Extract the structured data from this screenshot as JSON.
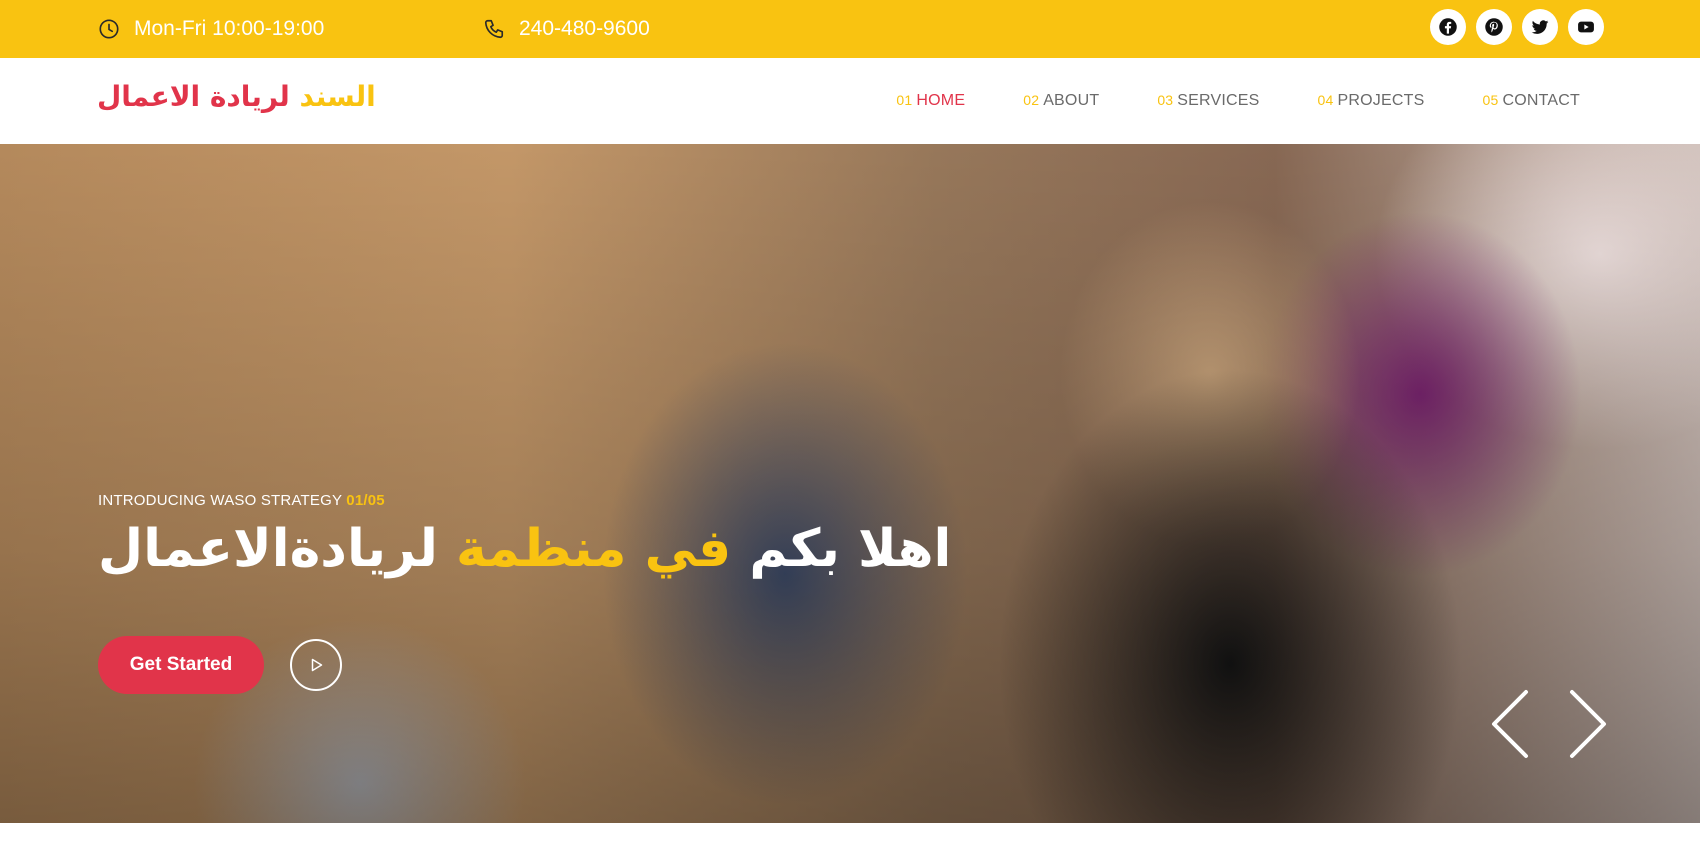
{
  "topbar": {
    "hours": "Mon-Fri 10:00-19:00",
    "phone": "240-480-9600",
    "socials": [
      {
        "name": "facebook-icon"
      },
      {
        "name": "pinterest-icon"
      },
      {
        "name": "twitter-icon"
      },
      {
        "name": "youtube-icon"
      }
    ]
  },
  "header": {
    "logo_part1": "السند",
    "logo_part2": "لريادة الاعمال",
    "nav": [
      {
        "num": "01",
        "label": "HOME",
        "active": true
      },
      {
        "num": "02",
        "label": "ABOUT"
      },
      {
        "num": "03",
        "label": "SERVICES"
      },
      {
        "num": "04",
        "label": "PROJECTS"
      },
      {
        "num": "05",
        "label": "CONTACT"
      }
    ]
  },
  "hero": {
    "intro": "INTRODUCING WASO STRATEGY",
    "counter": "01/05",
    "title_start": "اهلا بكم",
    "title_highlight": "في منظمة",
    "title_end": "لريادةالاعمال",
    "cta_label": "Get Started"
  },
  "colors": {
    "accent_yellow": "#f9c311",
    "accent_red": "#e1344a"
  }
}
